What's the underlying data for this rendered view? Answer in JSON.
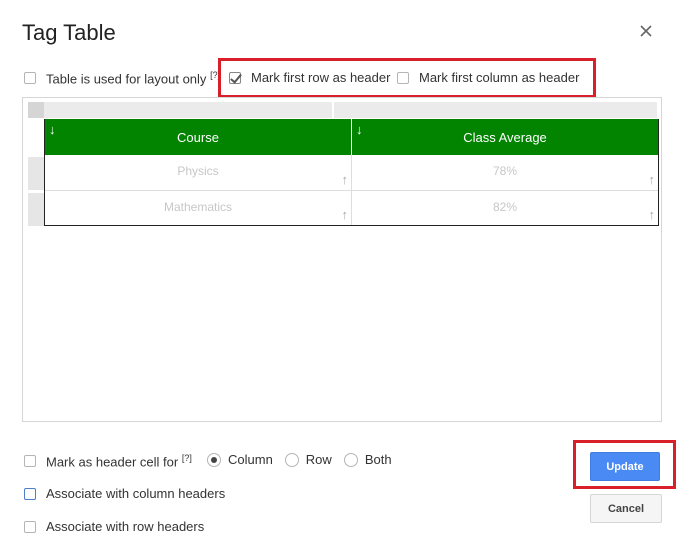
{
  "dialog": {
    "title": "Tag Table"
  },
  "options": {
    "layout_only": {
      "label": "Table is used for layout only",
      "help": "[?]",
      "checked": false
    },
    "first_row_header": {
      "label": "Mark first row as header",
      "checked": true
    },
    "first_col_header": {
      "label": "Mark first column as header",
      "checked": false
    }
  },
  "table": {
    "header": [
      "Course",
      "Class Average"
    ],
    "header_color": "#028401",
    "rows": [
      [
        "Physics",
        "78%"
      ],
      [
        "Mathematics",
        "82%"
      ]
    ]
  },
  "bottom": {
    "mark_header_cell": {
      "label": "Mark as header cell for",
      "help": "[?]",
      "checked": false
    },
    "radios": [
      {
        "label": "Column",
        "selected": true
      },
      {
        "label": "Row",
        "selected": false
      },
      {
        "label": "Both",
        "selected": false
      }
    ],
    "assoc_col": {
      "label": "Associate with column headers",
      "checked": false
    },
    "assoc_row": {
      "label": "Associate with row headers",
      "checked": false
    }
  },
  "buttons": {
    "update": "Update",
    "cancel": "Cancel"
  },
  "icons": {
    "close": "close-icon",
    "arrow_down": "arrow-down-icon",
    "arrow_up": "arrow-up-icon"
  },
  "colors": {
    "highlight": "#d9202a",
    "primary_button": "#4a8af4"
  }
}
